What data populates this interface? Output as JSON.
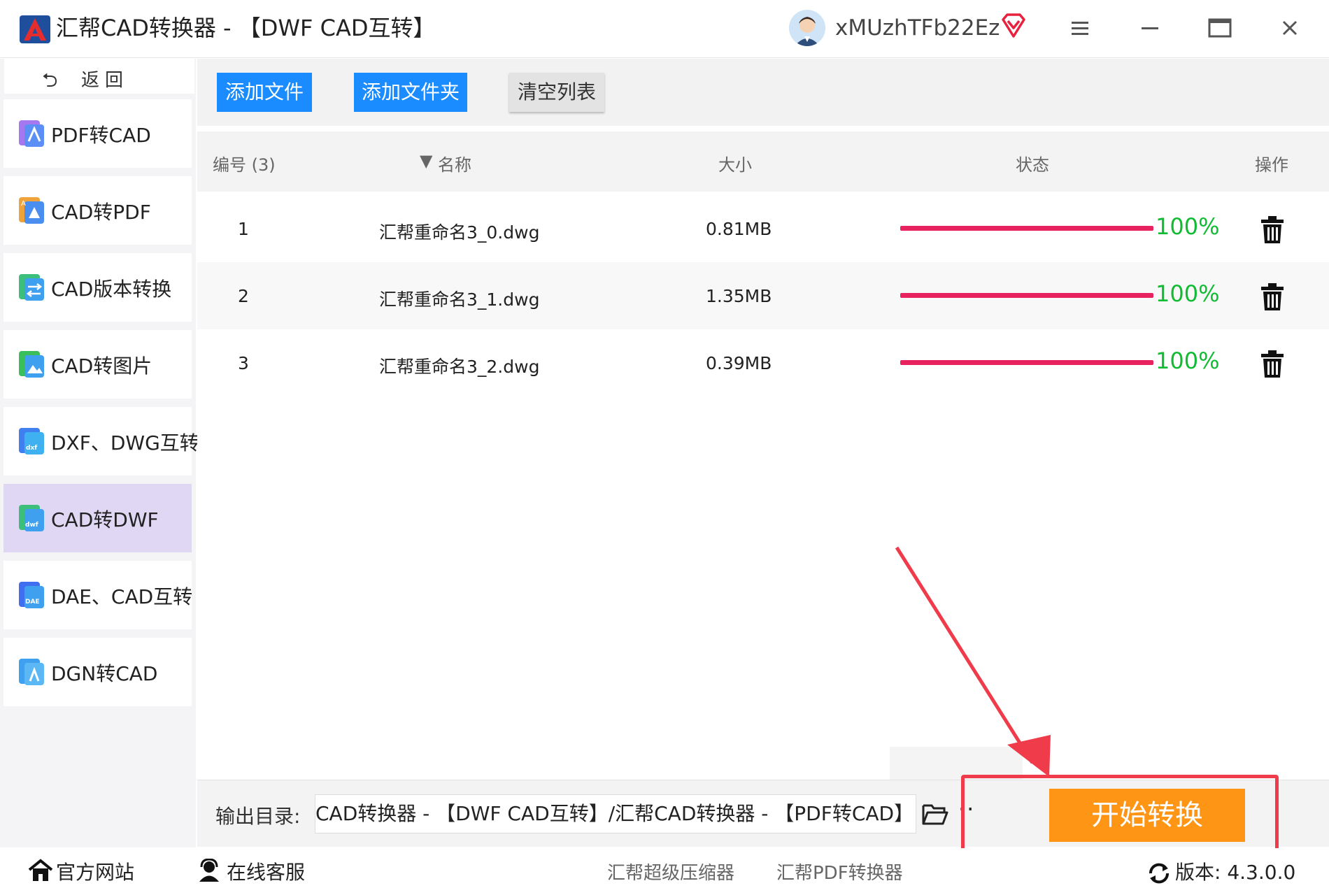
{
  "window": {
    "title": "汇帮CAD转换器 - 【DWF CAD互转】",
    "username": "xMUzhTFb22Ez"
  },
  "sidebar": {
    "back_label": "返回",
    "items": [
      {
        "label": "PDF转CAD",
        "icon": "pdf-to-cad-icon"
      },
      {
        "label": "CAD转PDF",
        "icon": "cad-to-pdf-icon"
      },
      {
        "label": "CAD版本转换",
        "icon": "cad-version-icon"
      },
      {
        "label": "CAD转图片",
        "icon": "cad-to-image-icon"
      },
      {
        "label": "DXF、DWG互转",
        "icon": "dxf-dwg-icon"
      },
      {
        "label": "CAD转DWF",
        "icon": "cad-to-dwf-icon",
        "active": true
      },
      {
        "label": "DAE、CAD互转",
        "icon": "dae-cad-icon"
      },
      {
        "label": "DGN转CAD",
        "icon": "dgn-to-cad-icon"
      }
    ]
  },
  "toolbar": {
    "add_file": "添加文件",
    "add_folder": "添加文件夹",
    "clear_list": "清空列表"
  },
  "table": {
    "headers": {
      "index": "编号 (3)",
      "name": "名称",
      "size": "大小",
      "status": "状态",
      "action": "操作"
    },
    "rows": [
      {
        "index": "1",
        "name": "汇帮重命名3_0.dwg",
        "size": "0.81MB",
        "progress": "100%"
      },
      {
        "index": "2",
        "name": "汇帮重命名3_1.dwg",
        "size": "1.35MB",
        "progress": "100%"
      },
      {
        "index": "3",
        "name": "汇帮重命名3_2.dwg",
        "size": "0.39MB",
        "progress": "100%"
      }
    ]
  },
  "output": {
    "label": "输出目录:",
    "path": "CAD转换器 - 【DWF CAD互转】/汇帮CAD转换器 - 【PDF转CAD】",
    "more": "··"
  },
  "start_button": "开始转换",
  "footer": {
    "website": "官方网站",
    "support": "在线客服",
    "compressor": "汇帮超级压缩器",
    "pdf_converter": "汇帮PDF转换器",
    "version": "版本: 4.3.0.0"
  },
  "colors": {
    "accent_blue": "#1a8cff",
    "start_orange": "#ff9514",
    "progress_bar": "#e8215f",
    "progress_text": "#11bb33",
    "highlight_red": "#f03c4a",
    "active_nav": "#e0d7f5"
  }
}
